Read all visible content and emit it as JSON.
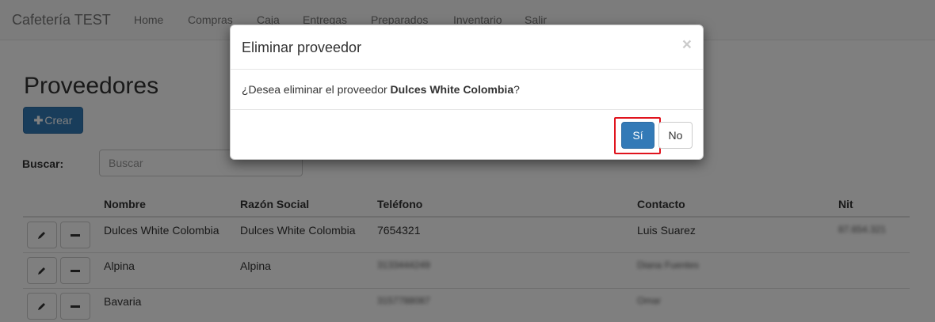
{
  "navbar": {
    "brand": "Cafetería TEST",
    "links": [
      "Home",
      "Compras",
      "Caja",
      "Entregas",
      "Preparados",
      "Inventario",
      "Salir"
    ]
  },
  "page": {
    "title": "Proveedores",
    "create_label": "Crear",
    "search_label": "Buscar:",
    "search_placeholder": "Buscar"
  },
  "table": {
    "headers": [
      "Nombre",
      "Razón Social",
      "Teléfono",
      "Contacto",
      "Nit"
    ],
    "rows": [
      {
        "nombre": "Dulces White Colombia",
        "razon": "Dulces White Colombia",
        "telefono": "7654321",
        "contacto": "Luis Suarez",
        "nit": "87.654.321"
      },
      {
        "nombre": "Alpina",
        "razon": "Alpina",
        "telefono": "3133444249",
        "contacto": "Diana Fuentes",
        "nit": ""
      },
      {
        "nombre": "Bavaria",
        "razon": "",
        "telefono": "3157788087",
        "contacto": "Omar",
        "nit": ""
      }
    ]
  },
  "modal": {
    "title": "Eliminar proveedor",
    "close_symbol": "×",
    "message_prefix": "¿Desea eliminar el proveedor ",
    "message_name": "Dulces White Colombia",
    "message_suffix": "?",
    "yes_label": "Sí",
    "no_label": "No"
  },
  "colors": {
    "primary": "#337ab7",
    "highlight": "#e0141e",
    "overlay": "rgba(0,0,0,0.5)"
  },
  "icons": {
    "edit": "pencil-icon",
    "delete": "minus-icon",
    "create": "plus-icon"
  }
}
